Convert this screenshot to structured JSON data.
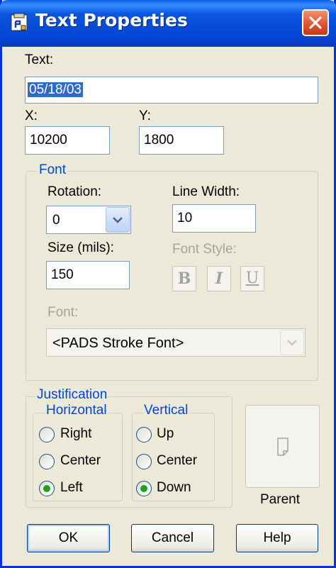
{
  "window": {
    "title": "Text Properties",
    "title_icon": "pads-app-icon",
    "close_icon": "close-icon"
  },
  "text": {
    "label": "Text:",
    "value": "05/18/03"
  },
  "x": {
    "label": "X:",
    "value": "10200"
  },
  "y": {
    "label": "Y:",
    "value": "1800"
  },
  "font_group": {
    "label": "Font",
    "rotation": {
      "label": "Rotation:",
      "value": "0"
    },
    "line_width": {
      "label": "Line Width:",
      "value": "10"
    },
    "size": {
      "label": "Size (mils):",
      "value": "150"
    },
    "font_style": {
      "label": "Font Style:",
      "bold": "B",
      "italic": "I",
      "underline": "U"
    },
    "font": {
      "label": "Font:",
      "value": "<PADS Stroke Font>"
    }
  },
  "justification": {
    "label": "Justification",
    "horizontal": {
      "label": "Horizontal",
      "options": [
        "Right",
        "Center",
        "Left"
      ],
      "selected": "Left"
    },
    "vertical": {
      "label": "Vertical",
      "options": [
        "Up",
        "Center",
        "Down"
      ],
      "selected": "Down"
    }
  },
  "parent": {
    "label": "Parent",
    "icon": "parent-page-icon"
  },
  "buttons": {
    "ok": "OK",
    "cancel": "Cancel",
    "help": "Help"
  },
  "colors": {
    "title_bar": "#0a55e0",
    "dialog_bg": "#ece9d8",
    "group_label": "#0046d5",
    "selection": "#316ac5",
    "disabled_text": "#a5a49c",
    "close_button": "#e0502b"
  }
}
